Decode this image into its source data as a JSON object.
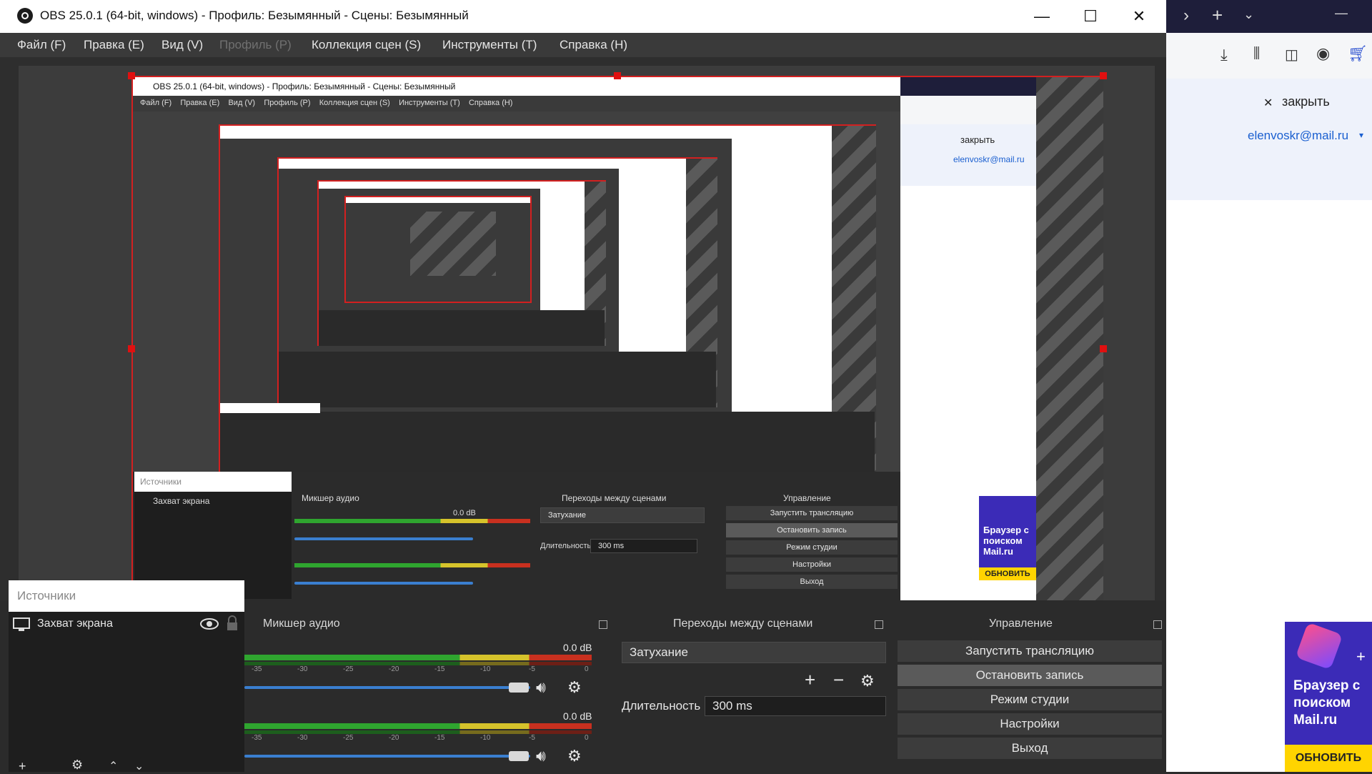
{
  "window": {
    "title": "OBS 25.0.1 (64-bit, windows) - Профиль: Безымянный - Сцены: Безымянный",
    "minimize_glyph": "—",
    "maximize_glyph": "☐",
    "close_glyph": "✕"
  },
  "menu": [
    {
      "label": "Файл (F)",
      "enabled": true
    },
    {
      "label": "Правка (E)",
      "enabled": true
    },
    {
      "label": "Вид (V)",
      "enabled": true
    },
    {
      "label": "Профиль (P)",
      "enabled": false
    },
    {
      "label": "Коллекция сцен (S)",
      "enabled": true
    },
    {
      "label": "Инструменты (T)",
      "enabled": true
    },
    {
      "label": "Справка (H)",
      "enabled": true
    }
  ],
  "preview": {
    "nested_title": "OBS 25.0.1 (64-bit, windows) - Профиль: Безымянный - Сцены: Безымянный",
    "nested_menu": "Файл (F)    Правка (E)    Вид (V)    Профиль (P)    Коллекция сцен (S)    Инструменты (T)    Справка (H)",
    "nested_sources": "Источники",
    "nested_source_item": "Захват экрана",
    "nested_mixer": "Микшер аудио",
    "nested_transitions": "Переходы между сценами",
    "nested_controls": "Управление",
    "nested_fade": "Затухание",
    "nested_duration_label": "Длительность",
    "nested_duration": "300 ms",
    "nested_buttons": [
      "Запустить трансляцию",
      "Остановить запись",
      "Режим студии",
      "Настройки",
      "Выход"
    ],
    "nested_close": "закрыть",
    "nested_email": "elenvoskr@mail.ru",
    "nested_ad_text": "Браузер с поиском Mail.ru",
    "nested_ad_button": "ОБНОВИТЬ",
    "nested_db": "0.0 dB"
  },
  "sources": {
    "title": "Источники",
    "items": [
      {
        "name": "Захват экрана",
        "visible": true,
        "locked": false
      }
    ]
  },
  "mixer": {
    "title": "Микшер аудио",
    "channels": [
      {
        "db": "0.0 dB",
        "volume": 0.95
      },
      {
        "db": "0.0 dB",
        "volume": 0.95
      }
    ],
    "ticks": [
      "-35",
      "-30",
      "-25",
      "-20",
      "-15",
      "-10",
      "-5",
      "0"
    ]
  },
  "transitions": {
    "title": "Переходы между сценами",
    "selected": "Затухание",
    "duration_label": "Длительность",
    "duration_value": "300 ms"
  },
  "controls": {
    "title": "Управление",
    "buttons": [
      {
        "label": "Запустить трансляцию",
        "active": false
      },
      {
        "label": "Остановить запись",
        "active": true
      },
      {
        "label": "Режим студии",
        "active": false
      },
      {
        "label": "Настройки",
        "active": false
      },
      {
        "label": "Выход",
        "active": false
      }
    ]
  },
  "browser": {
    "close_label": "закрыть",
    "email": "elenvoskr@mail.ru",
    "ad_text": "Браузер с поиском Mail.ru",
    "ad_button": "ОБНОВИТЬ"
  },
  "colors": {
    "selection_border": "#d32020",
    "meter_green": "#2fa52f",
    "meter_yellow": "#d6c32b",
    "meter_red": "#c8301f",
    "volume_blue": "#3a7fd0",
    "link_blue": "#1a5fd0",
    "ad_purple": "#3b2bb7",
    "ad_yellow": "#ffd400"
  }
}
